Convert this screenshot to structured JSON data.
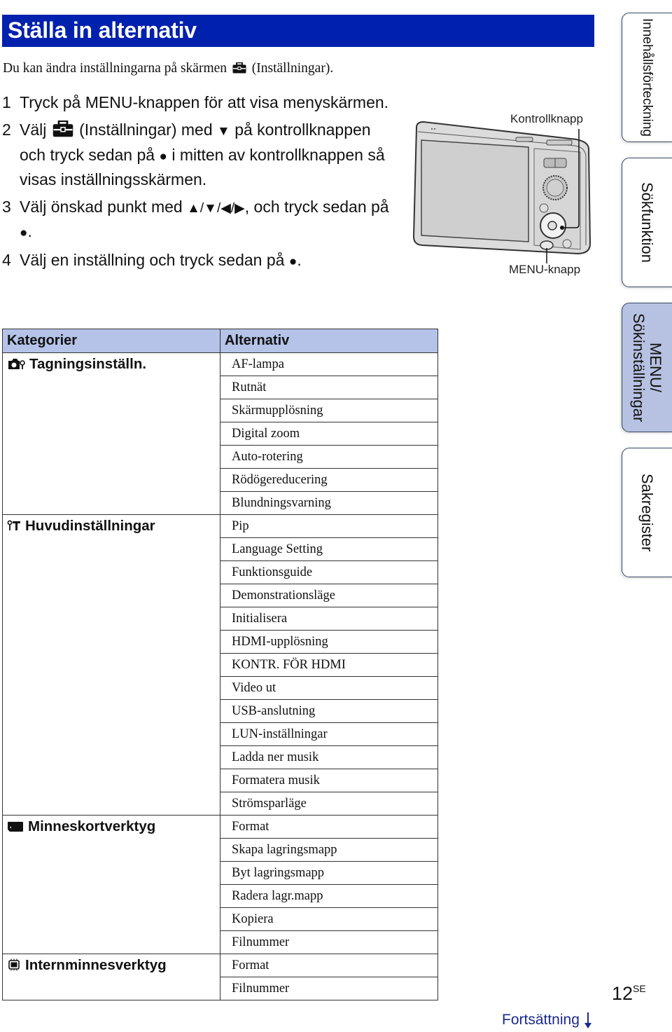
{
  "title": "Ställa in alternativ",
  "intro": {
    "before": "Du kan ändra inställningarna på skärmen",
    "icon": "toolbox-icon",
    "after": "(Inställningar)."
  },
  "steps": [
    {
      "num": "1",
      "text": "Tryck på MENU-knappen för att visa menyskärmen."
    },
    {
      "num": "2",
      "text_a": "Välj",
      "text_b": "(Inställningar) med",
      "down": "▼",
      "text_c": "på kontrollknappen och tryck sedan på",
      "dot": "●",
      "text_d": "i mitten av kontrollknappen så visas inställningsskärmen."
    },
    {
      "num": "3",
      "text_a": "Välj önskad punkt med",
      "arrows": "▲/▼/◀/▶",
      "text_b": ", och tryck sedan på",
      "dot": "●",
      "text_c": "."
    },
    {
      "num": "4",
      "text_a": "Välj en inställning och tryck sedan på",
      "dot": "●",
      "text_b": "."
    }
  ],
  "camera": {
    "label_control": "Kontrollknapp",
    "label_menu": "MENU-knapp"
  },
  "side_tabs": [
    {
      "label": "Innehållsförteckning",
      "active": false
    },
    {
      "label": "Sökfunktion",
      "active": false
    },
    {
      "label_line1": "MENU/",
      "label_line2": "Sökinställningar",
      "active": true
    },
    {
      "label": "Sakregister",
      "active": false
    }
  ],
  "table": {
    "headers": [
      "Kategorier",
      "Alternativ"
    ],
    "categories": [
      {
        "name": "Tagningsinställn.",
        "icon": "camera-settings-icon",
        "options": [
          "AF-lampa",
          "Rutnät",
          "Skärmupplösning",
          "Digital zoom",
          "Auto-rotering",
          "Rödögereducering",
          "Blundningsvarning"
        ]
      },
      {
        "name": "Huvudinställningar",
        "icon": "tools-icon",
        "options": [
          "Pip",
          "Language Setting",
          "Funktionsguide",
          "Demonstrationsläge",
          "Initialisera",
          "HDMI-upplösning",
          "KONTR. FÖR HDMI",
          "Video ut",
          "USB-anslutning",
          "LUN-inställningar",
          "Ladda ner musik",
          "Formatera musik",
          "Strömsparläge"
        ]
      },
      {
        "name": "Minneskortverktyg",
        "icon": "memory-card-icon",
        "options": [
          "Format",
          "Skapa lagringsmapp",
          "Byt lagringsmapp",
          "Radera lagr.mapp",
          "Kopiera",
          "Filnummer"
        ]
      },
      {
        "name": "Internminnesverktyg",
        "icon": "internal-memory-icon",
        "options": [
          "Format",
          "Filnummer"
        ]
      }
    ]
  },
  "footer": {
    "page": "12",
    "page_suffix": "SE",
    "continue_label": "Fortsättning"
  },
  "colors": {
    "title_bg": "#0020ae",
    "header_bg": "#b5c3e8",
    "active_tab_bg": "#b7c2e2",
    "continue_text": "#1b2a8c"
  }
}
